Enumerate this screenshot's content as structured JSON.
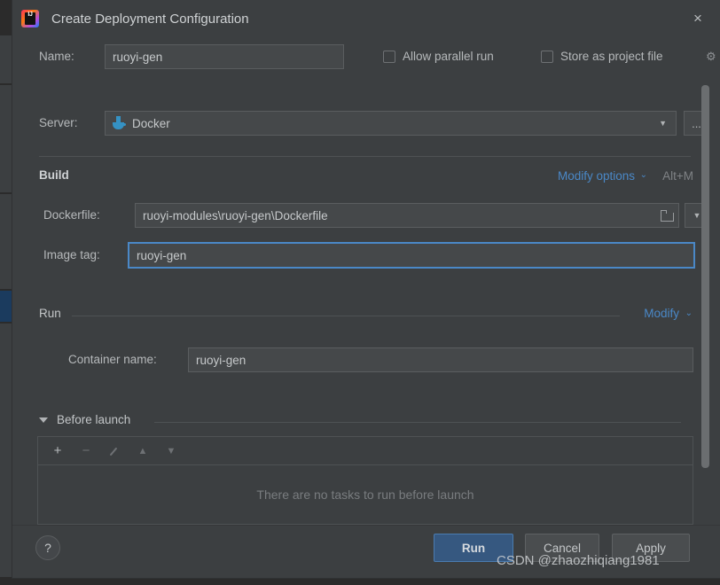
{
  "window": {
    "title": "Create Deployment Configuration",
    "logo_icon": "intellij-idea-logo",
    "logo_text": "IJ",
    "close_icon": "×"
  },
  "name_row": {
    "label": "Name:",
    "value": "ruoyi-gen",
    "allow_parallel_run": "Allow parallel run",
    "store_as_project_file": "Store as project file",
    "gear_icon": "⚙"
  },
  "server_row": {
    "label": "Server:",
    "value": "Docker",
    "server_icon": "docker-icon",
    "dropdown_icon": "▼",
    "ellipsis_label": "..."
  },
  "build": {
    "title": "Build",
    "modify_options": "Modify options",
    "modify_options_arrow": "⌄",
    "shortcut": "Alt+M",
    "dockerfile_label": "Dockerfile:",
    "dockerfile_value": "ruoyi-modules\\ruoyi-gen\\Dockerfile",
    "folder_icon": "folder-icon",
    "dropdown_icon": "▼",
    "imagetag_label": "Image tag:",
    "imagetag_value": "ruoyi-gen"
  },
  "run": {
    "title": "Run",
    "modify": "Modify",
    "modify_arrow": "⌄",
    "container_label": "Container name:",
    "container_value": "ruoyi-gen"
  },
  "before_launch": {
    "title": "Before launch",
    "collapse_icon": "▼",
    "toolbar": {
      "add": "+",
      "remove": "−",
      "edit": "pencil-icon",
      "move_up": "▲",
      "move_down": "▼"
    },
    "empty_message": "There are no tasks to run before launch"
  },
  "footer": {
    "help_label": "?",
    "run_label": "Run",
    "cancel_label": "Cancel",
    "apply_label": "Apply"
  },
  "watermark": "CSDN @zhaozhiqiang1981",
  "colors": {
    "dialog_bg": "#3c3f41",
    "field_bg": "#45484a",
    "accent_blue": "#4a88c7",
    "primary_button": "#365880",
    "docker_blue": "#3592c4",
    "muted_text": "#797c7f"
  }
}
